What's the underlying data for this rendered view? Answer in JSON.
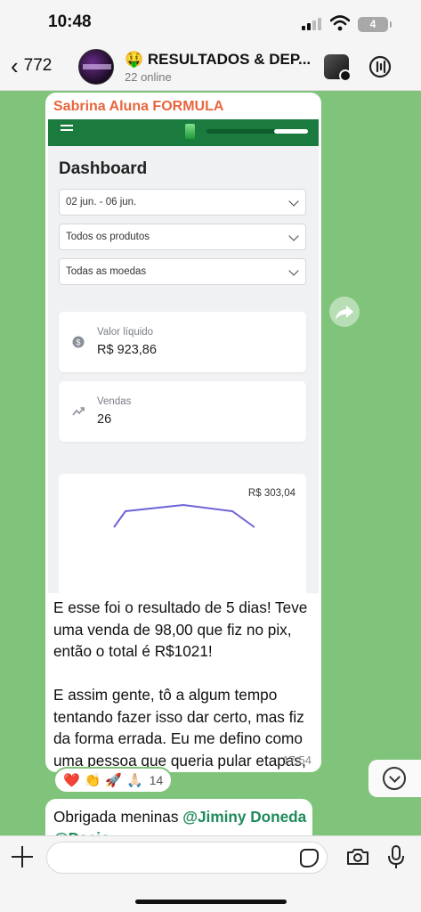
{
  "status_bar": {
    "time": "10:48",
    "battery": "4"
  },
  "header": {
    "back_count": "772",
    "title": "🤑 RESULTADOS & DEP...",
    "subtitle": "22 online"
  },
  "message": {
    "sender": "Sabrina Aluna FORMULA",
    "screenshot": {
      "title": "Dashboard",
      "date_filter": "02 jun. - 06 jun.",
      "products_filter": "Todos os produtos",
      "currency_filter": "Todas as moedas",
      "net_value_label": "Valor líquido",
      "net_value": "R$ 923,86",
      "sales_label": "Vendas",
      "sales_value": "26",
      "chart_value_label": "R$ 303,04"
    },
    "paragraph_1": "E esse foi o resultado de 5 dias! Teve uma venda de 98,00 que fiz no pix, então o total é R$1021!",
    "paragraph_2": "E assim gente, tô a algum tempo tentando fazer isso dar certo, mas fiz da forma errada. Eu me defino como uma pessoa que queria pular etapas, pulei várias e não conseguia. E no último mês prometi pra mim que ia fazer dar certo! E está dando🚀",
    "time": "17:54"
  },
  "reactions": {
    "emojis": [
      "❤️",
      "👏",
      "🚀",
      "🙏🏻"
    ],
    "count": "14"
  },
  "next_message": {
    "text": "Obrigada meninas ",
    "mention_1": "@Jiminy Doneda",
    "mention_2": "@Dacio"
  },
  "icons": {
    "back": "chevron-left-icon",
    "forward": "forward-share-icon",
    "scroll_down": "chevron-down-circle-icon",
    "add": "plus-icon",
    "sticker": "sticker-icon",
    "camera": "camera-icon",
    "mic": "microphone-icon",
    "channel": "channel-icon"
  },
  "colors": {
    "chat_background": "#7fc47a",
    "sender_name": "#e8663d",
    "mention": "#1f8a5b",
    "dashboard_topbar": "#1b7a3e"
  }
}
